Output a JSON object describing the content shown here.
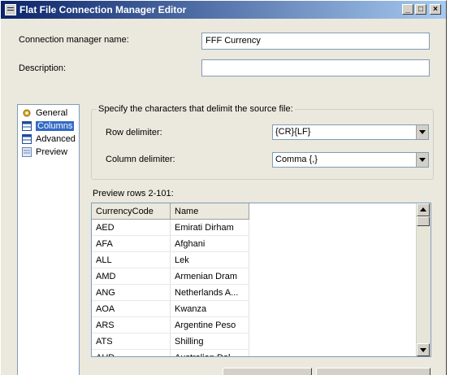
{
  "window": {
    "title": "Flat File Connection Manager Editor"
  },
  "titlebar_buttons": {
    "minimize": "_",
    "maximize": "□",
    "close": "×"
  },
  "connection_name": {
    "label": "Connection manager name:",
    "value": "FFF Currency"
  },
  "description": {
    "label": "Description:",
    "value": ""
  },
  "nav": {
    "items": [
      {
        "label": "General",
        "icon": "gear-icon",
        "selected": false
      },
      {
        "label": "Columns",
        "icon": "grid-icon",
        "selected": true
      },
      {
        "label": "Advanced",
        "icon": "grid-icon",
        "selected": false
      },
      {
        "label": "Preview",
        "icon": "preview-icon",
        "selected": false
      }
    ]
  },
  "delimiters": {
    "group_label": "Specify the characters that delimit the source file:",
    "row_label": "Row delimiter:",
    "row_value": "{CR}{LF}",
    "column_label": "Column delimiter:",
    "column_value": "Comma {,}"
  },
  "preview": {
    "label": "Preview rows 2-101:",
    "columns": [
      "CurrencyCode",
      "Name"
    ],
    "rows": [
      [
        "AED",
        "Emirati Dirham"
      ],
      [
        "AFA",
        "Afghani"
      ],
      [
        "ALL",
        "Lek"
      ],
      [
        "AMD",
        "Armenian Dram"
      ],
      [
        "ANG",
        "Netherlands A..."
      ],
      [
        "AOA",
        "Kwanza"
      ],
      [
        "ARS",
        "Argentine Peso"
      ],
      [
        "ATS",
        "Shilling"
      ],
      [
        "AUD",
        "Australian Dol..."
      ]
    ]
  },
  "colors": {
    "selection": "#316ac5",
    "titlebar": "#0a246a",
    "dialog_bg": "#ebe8dd"
  }
}
